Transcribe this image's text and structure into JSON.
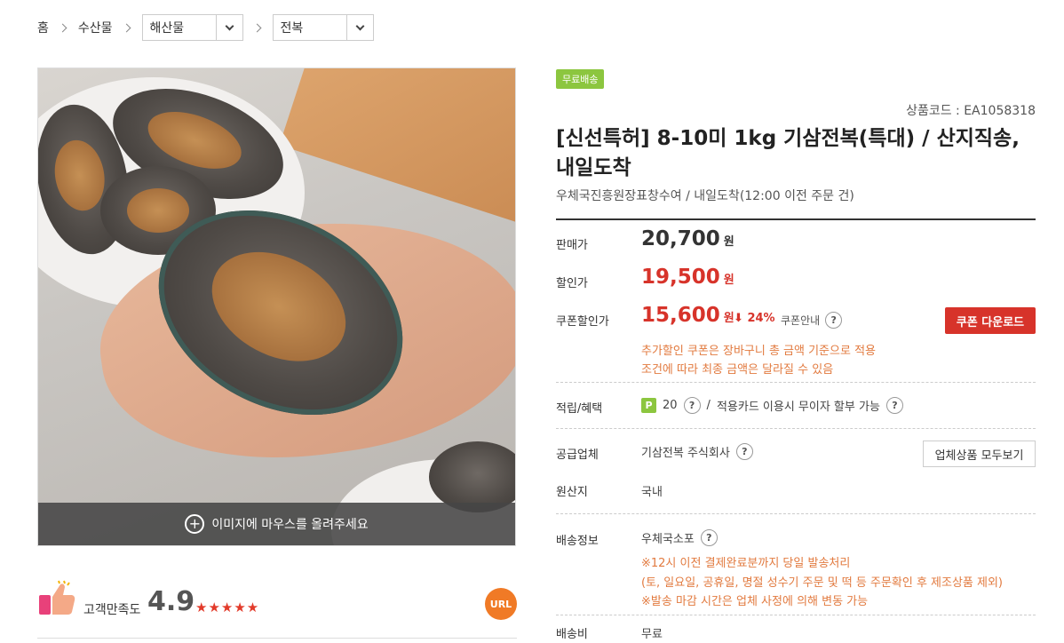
{
  "breadcrumb": {
    "home": "홈",
    "category1": "수산물",
    "category2": "해산물",
    "category3": "전복"
  },
  "image": {
    "hover_hint": "이미지에 마우스를 올려주세요"
  },
  "rating": {
    "label": "고객만족도",
    "score": "4.9",
    "stars": 5,
    "url_button": "URL"
  },
  "product": {
    "badge": "무료배송",
    "code": "상품코드 : EA1058318",
    "title": "[신선특허] 8-10미 1kg 기삼전복(특대) / 산지직송, 내일도착",
    "subtitle": "우체국진흥원장표창수여 / 내일도착(12:00 이전 주문 건)"
  },
  "price": {
    "sale_label": "판매가",
    "sale_value": "20,700",
    "discount_label": "할인가",
    "discount_value": "19,500",
    "coupon_label": "쿠폰할인가",
    "coupon_value": "15,600",
    "won": "원",
    "percent": "24%",
    "coupon_info": "쿠폰안내",
    "coupon_button": "쿠폰 다운로드",
    "notice1": "추가할인 쿠폰은 장바구니 총 금액 기준으로 적용",
    "notice2": "조건에 따라 최종 금액은 달라질 수 있음"
  },
  "benefit": {
    "label": "적립/혜택",
    "point_badge": "P",
    "points": "20",
    "slash": "/",
    "card_text": "적용카드 이용시 무이자 할부 가능"
  },
  "supplier": {
    "label": "공급업체",
    "name": "기삼전복 주식회사",
    "all_button": "업체상품 모두보기"
  },
  "origin": {
    "label": "원산지",
    "value": "국내"
  },
  "shipping": {
    "label": "배송정보",
    "method": "우체국소포",
    "note1": "※12시 이전 결제완료분까지 당일 발송처리",
    "note2": "(토, 일요일, 공휴일, 명절 성수기 주문 및 떡 등 주문확인 후 제조상품 제외)",
    "note3": "※발송 마감 시간은 업체 사정에 의해 변동 가능"
  },
  "fee": {
    "label": "배송비",
    "value": "무료"
  },
  "colors": {
    "accent_red": "#d7332a",
    "badge_green": "#8cc63f",
    "notice_orange": "#e27a3f",
    "url_orange": "#f07a26"
  }
}
